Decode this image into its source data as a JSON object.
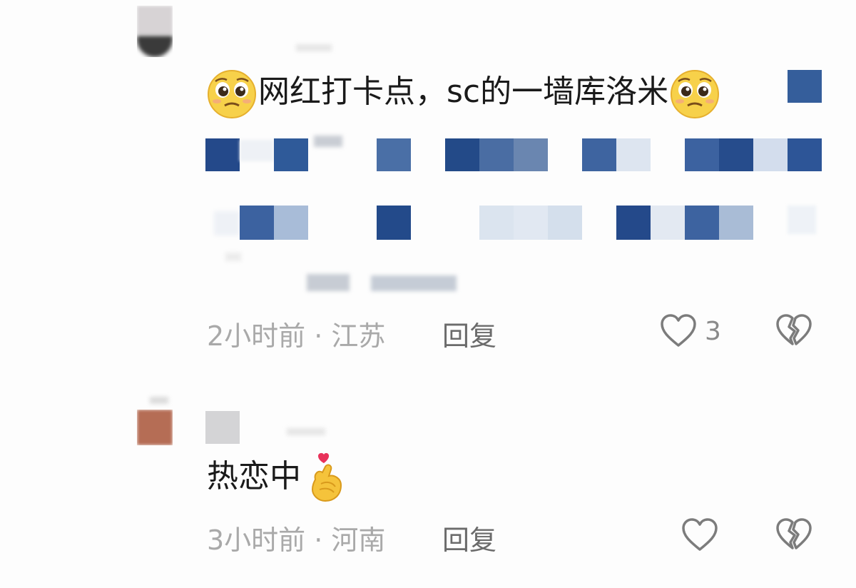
{
  "comments": [
    {
      "text": "网红打卡点，sc的一墙库洛米",
      "time_location": "2小时前 · 江苏",
      "reply_label": "回复",
      "like_count": "3",
      "emojis": [
        "pleading-face-icon",
        "pleading-face-icon"
      ]
    },
    {
      "text": "热恋中",
      "time_location": "3小时前 · 河南",
      "reply_label": "回复",
      "like_count": "",
      "emojis": [
        "finger-heart-icon"
      ]
    }
  ],
  "colors": {
    "mosaic_dark": "#244a86",
    "mosaic_mid": "#3f66a3",
    "mosaic_light": "#b9c9df",
    "meta_gray": "#a9a9a9",
    "reply_gray": "#6b6b6b",
    "icon_gray": "#7c7c7c"
  }
}
